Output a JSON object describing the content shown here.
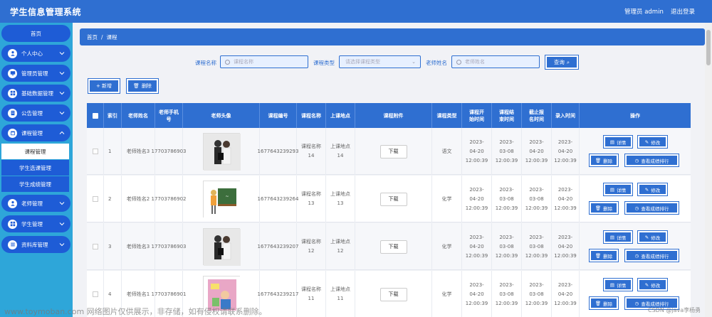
{
  "app": {
    "title": "学生信息管理系统",
    "user_label": "管理员 admin",
    "logout_label": "退出登录"
  },
  "sidebar": {
    "home": "首页",
    "items": [
      {
        "label": "个人中心",
        "icon": "user-icon"
      },
      {
        "label": "管理员管理",
        "icon": "monitor-icon"
      },
      {
        "label": "基础数据管理",
        "icon": "grid-icon"
      },
      {
        "label": "公告管理",
        "icon": "document-icon"
      },
      {
        "label": "课程管理",
        "icon": "calendar-icon"
      }
    ],
    "submenu": [
      "课程管理",
      "学生选课管理",
      "学生成绩管理"
    ],
    "items2": [
      {
        "label": "老师管理",
        "icon": "user-icon"
      },
      {
        "label": "学生管理",
        "icon": "grid-icon"
      },
      {
        "label": "资料库管理",
        "icon": "list-icon"
      }
    ]
  },
  "breadcrumb": {
    "home": "首页",
    "sep": "/",
    "current": "课程"
  },
  "filters": {
    "course_name_label": "课程名称",
    "course_name_placeholder": "课程名称",
    "course_type_label": "课程类型",
    "course_type_placeholder": "请选择课程类型",
    "teacher_name_label": "老师姓名",
    "teacher_name_placeholder": "老师姓名",
    "query_label": "查询"
  },
  "toolbar": {
    "add_label": "+ 新增",
    "delete_label": "删除"
  },
  "table": {
    "headers": [
      "索引",
      "老师姓名",
      "老师手机号",
      "老师头像",
      "课程编号",
      "课程名称",
      "上课地点",
      "课程附件",
      "课程类型",
      "课程开始时间",
      "课程结束时间",
      "截止报名时间",
      "录入时间",
      "操作"
    ],
    "download_label": "下载",
    "op_labels": {
      "detail": "详情",
      "edit": "修改",
      "delete": "删除",
      "rank": "查看成绩排行"
    },
    "rows": [
      {
        "index": "1",
        "teacher": "老师姓名3",
        "phone": "17703786903",
        "code": "1677643239293",
        "name": "课程名称14",
        "place": "上课地点14",
        "type": "语文",
        "start": "2023-04-20 12:00:39",
        "end": "2023-03-08 12:00:39",
        "deadline": "2023-04-20 12:00:39",
        "created": "2023-04-20 12:00:39"
      },
      {
        "index": "2",
        "teacher": "老师姓名2",
        "phone": "17703786902",
        "code": "1677643239264",
        "name": "课程名称13",
        "place": "上课地点13",
        "type": "化学",
        "start": "2023-04-20 12:00:39",
        "end": "2023-03-08 12:00:39",
        "deadline": "2023-03-08 12:00:39",
        "created": "2023-04-20 12:00:39"
      },
      {
        "index": "3",
        "teacher": "老师姓名3",
        "phone": "17703786903",
        "code": "1677643239207",
        "name": "课程名称12",
        "place": "上课地点12",
        "type": "化学",
        "start": "2023-04-20 12:00:39",
        "end": "2023-03-08 12:00:39",
        "deadline": "2023-03-08 12:00:39",
        "created": "2023-04-20 12:00:39"
      },
      {
        "index": "4",
        "teacher": "老师姓名1",
        "phone": "17703786901",
        "code": "1677643239217",
        "name": "课程名称11",
        "place": "上课地点11",
        "type": "化学",
        "start": "2023-04-20 12:00:39",
        "end": "2023-03-08 12:00:39",
        "deadline": "2023-03-08 12:00:39",
        "created": "2023-04-20 12:00:39"
      }
    ]
  },
  "watermark": "www.toymoban.com 网络图片仅供展示，非存储，如有侵权请联系删除。",
  "credit": "CSDN @java李杨勇",
  "colors": {
    "primary": "#2f6fd1",
    "sidebar": "#2ea6d9",
    "menu": "#1e5cd6"
  }
}
